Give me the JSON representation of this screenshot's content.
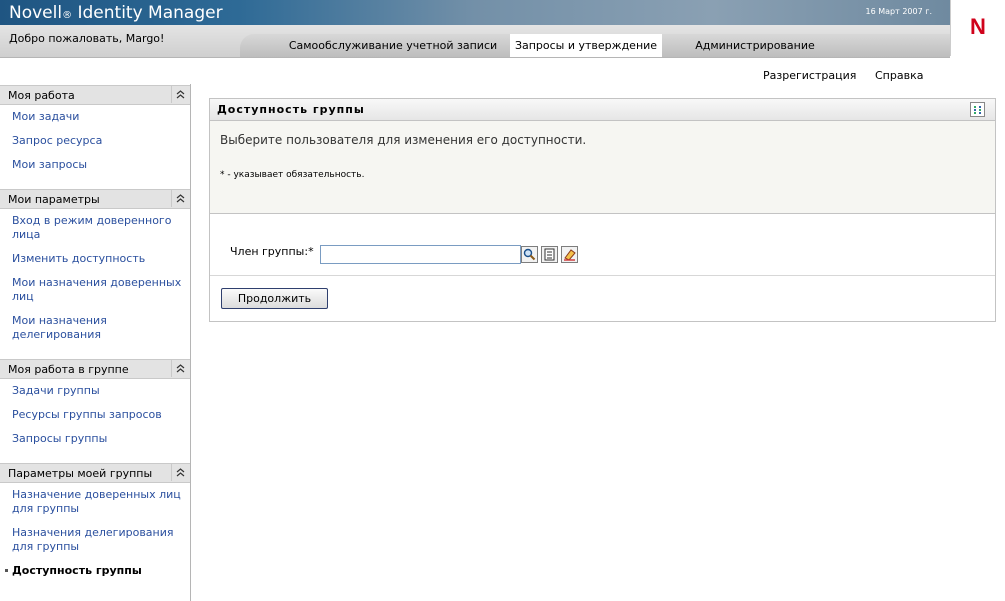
{
  "header": {
    "brand_name": "Novell",
    "brand_reg": "®",
    "brand_product": " Identity Manager",
    "date": "16 Март 2007 г.",
    "welcome": "Добро пожаловать, Margo!",
    "logo": "N",
    "accent_color": "#d0021b"
  },
  "tabs": [
    {
      "label": "Самообслуживание учетной записи"
    },
    {
      "label": "Запросы и утверждение"
    },
    {
      "label": "Администрирование"
    }
  ],
  "top_links": {
    "logout": "Разрегистрация",
    "help": "Справка"
  },
  "sidebar": {
    "sections": [
      {
        "title": "Моя работа",
        "items": [
          {
            "label": "Мои задачи"
          },
          {
            "label": "Запрос ресурса"
          },
          {
            "label": "Мои запросы"
          }
        ]
      },
      {
        "title": "Мои параметры",
        "items": [
          {
            "label": "Вход в режим доверенного лица"
          },
          {
            "label": "Изменить доступность"
          },
          {
            "label": "Мои назначения доверенных лиц"
          },
          {
            "label": "Мои назначения делегирования"
          }
        ]
      },
      {
        "title": "Моя работа в группе",
        "items": [
          {
            "label": "Задачи группы"
          },
          {
            "label": "Ресурсы группы запросов"
          },
          {
            "label": "Запросы группы"
          }
        ]
      },
      {
        "title": "Параметры моей группы",
        "items": [
          {
            "label": "Назначение доверенных лиц для группы"
          },
          {
            "label": "Назначения делегирования для группы"
          },
          {
            "label": "Доступность группы"
          }
        ]
      }
    ]
  },
  "panel": {
    "title": "Доступность группы",
    "instruction": "Выберите пользователя для изменения его доступности.",
    "required_note": "* - указывает обязательность.",
    "field_label": "Член группы:*",
    "field_value": "",
    "continue_label": "Продолжить"
  }
}
